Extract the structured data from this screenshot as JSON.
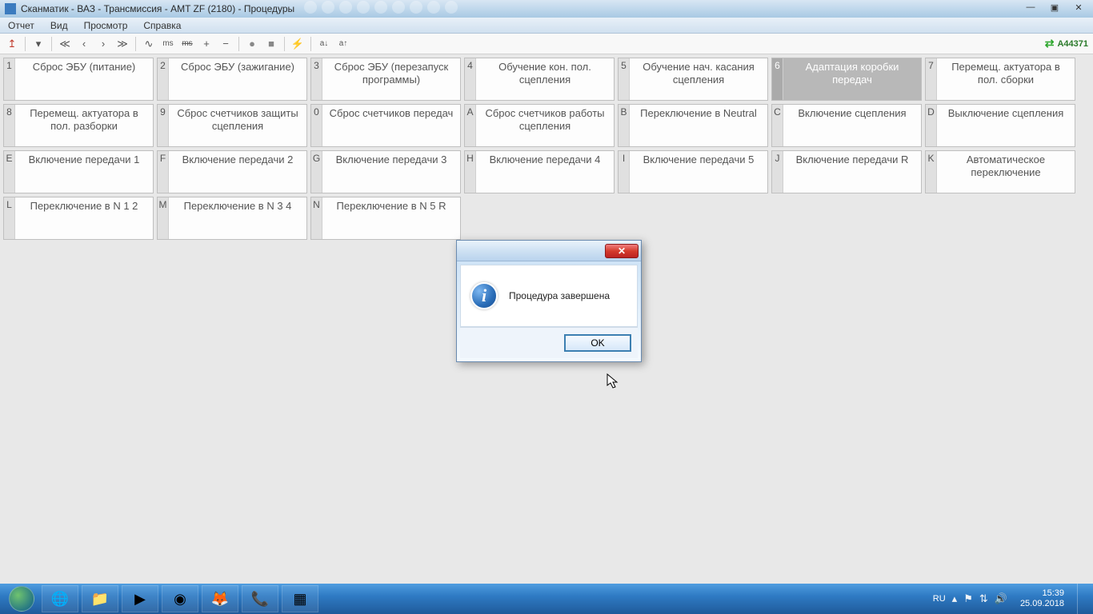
{
  "window": {
    "title": "Сканматик - ВАЗ - Трансмиссия - AMT ZF (2180) - Процедуры"
  },
  "menu": {
    "items": [
      "Отчет",
      "Вид",
      "Просмотр",
      "Справка"
    ]
  },
  "toolbar": {
    "status_code": "A44371"
  },
  "procedures": [
    {
      "key": "1",
      "label": "Сброс ЭБУ (питание)"
    },
    {
      "key": "2",
      "label": "Сброс ЭБУ (зажигание)"
    },
    {
      "key": "3",
      "label": "Сброс ЭБУ (перезапуск программы)"
    },
    {
      "key": "4",
      "label": "Обучение кон. пол. сцепления"
    },
    {
      "key": "5",
      "label": "Обучение нач. касания сцепления"
    },
    {
      "key": "6",
      "label": "Адаптация коробки передач",
      "selected": true
    },
    {
      "key": "7",
      "label": "Перемещ. актуатора в пол. сборки"
    },
    {
      "key": "8",
      "label": "Перемещ. актуатора в пол. разборки"
    },
    {
      "key": "9",
      "label": "Сброс счетчиков защиты сцепления"
    },
    {
      "key": "0",
      "label": "Сброс счетчиков передач"
    },
    {
      "key": "A",
      "label": "Сброс счетчиков работы сцепления"
    },
    {
      "key": "B",
      "label": "Переключение в Neutral"
    },
    {
      "key": "C",
      "label": "Включение сцепления"
    },
    {
      "key": "D",
      "label": "Выключение сцепления"
    },
    {
      "key": "E",
      "label": "Включение передачи 1"
    },
    {
      "key": "F",
      "label": "Включение передачи 2"
    },
    {
      "key": "G",
      "label": "Включение передачи 3"
    },
    {
      "key": "H",
      "label": "Включение передачи 4"
    },
    {
      "key": "I",
      "label": "Включение передачи 5"
    },
    {
      "key": "J",
      "label": "Включение передачи R"
    },
    {
      "key": "K",
      "label": "Автоматическое переключение"
    },
    {
      "key": "L",
      "label": "Переключение в N 1 2"
    },
    {
      "key": "M",
      "label": "Переключение в N 3 4"
    },
    {
      "key": "N",
      "label": "Переключение в N 5 R"
    }
  ],
  "dialog": {
    "message": "Процедура завершена",
    "ok": "OK",
    "close_glyph": "✕"
  },
  "taskbar": {
    "lang": "RU",
    "time": "15:39",
    "date": "25.09.2018"
  }
}
